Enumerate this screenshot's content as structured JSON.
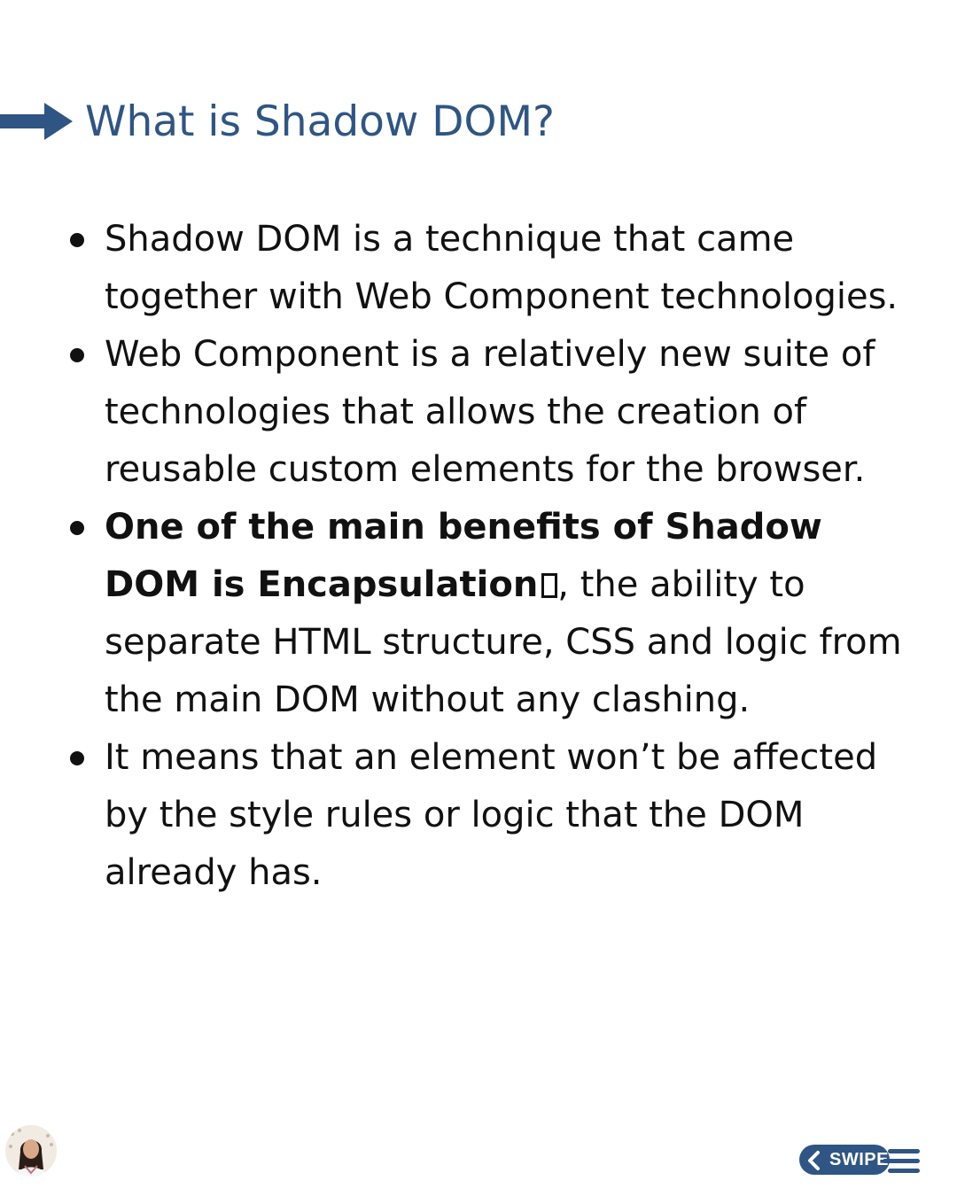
{
  "title": "What is Shadow DOM?",
  "bullets": [
    {
      "text": "Shadow DOM is a technique that came together with Web Component technologies."
    },
    {
      "text": "Web Component is a relatively new suite of technologies that allows the creation of reusable custom elements for the browser."
    },
    {
      "bold": "One of the main benefits of Shadow DOM is Encapsulation",
      "text": ", the ability to separate HTML structure, CSS and logic from the main DOM without any clashing."
    },
    {
      "text": "It means that an element won’t be affected by the style rules or logic that the DOM already has."
    }
  ],
  "footer": {
    "avatar_icon": "author-avatar",
    "swipe_label": "SWIPE"
  },
  "colors": {
    "accent": "#2f5584",
    "text": "#111111",
    "background": "#ffffff"
  }
}
